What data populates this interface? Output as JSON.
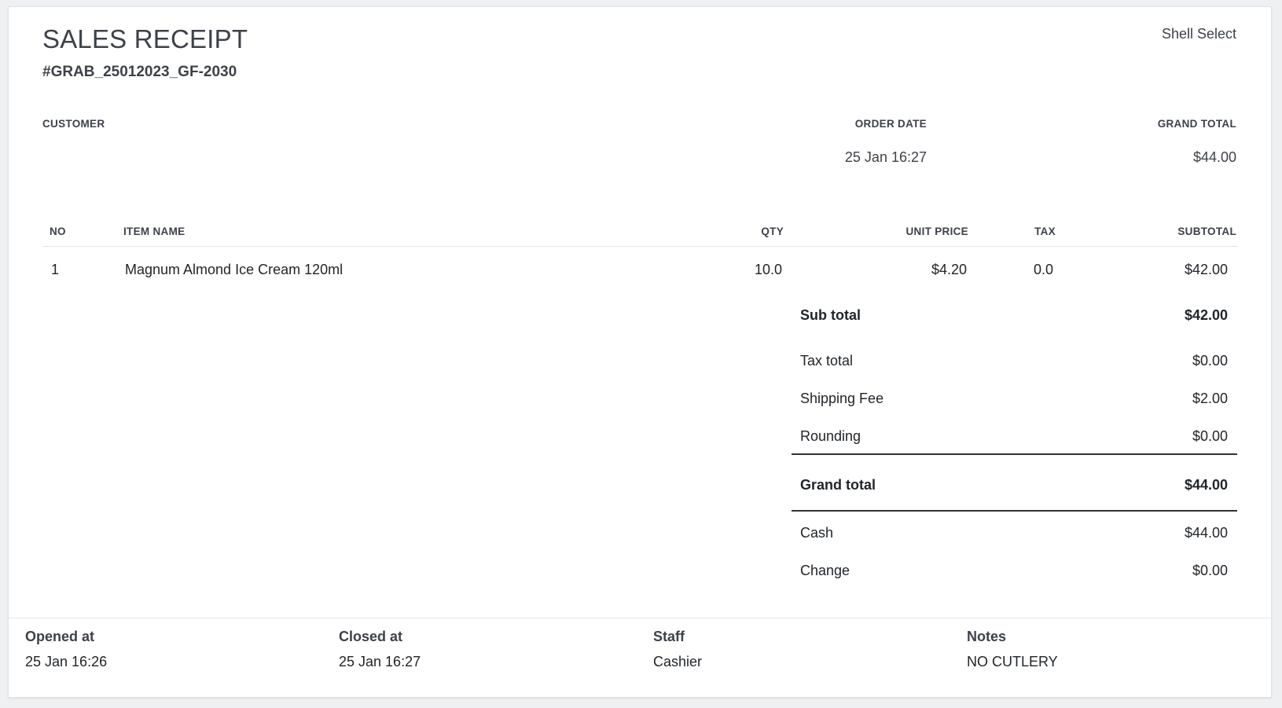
{
  "header": {
    "title": "SALES RECEIPT",
    "receipt_number": "#GRAB_25012023_GF-2030",
    "shop_name": "Shell Select"
  },
  "meta": {
    "customer_label": "CUSTOMER",
    "customer_value": "",
    "order_date_label": "ORDER DATE",
    "order_date_value": "25 Jan 16:27",
    "grand_total_label": "GRAND TOTAL",
    "grand_total_value": "$44.00"
  },
  "table": {
    "columns": [
      "NO",
      "ITEM NAME",
      "QTY",
      "UNIT PRICE",
      "TAX",
      "SUBTOTAL"
    ],
    "rows": [
      {
        "no": "1",
        "item_name": "Magnum Almond Ice Cream 120ml",
        "qty": "10.0",
        "unit_price": "$4.20",
        "tax": "0.0",
        "subtotal": "$42.00"
      }
    ]
  },
  "summary": {
    "sub_total_label": "Sub total",
    "sub_total_value": "$42.00",
    "tax_total_label": "Tax total",
    "tax_total_value": "$0.00",
    "shipping_fee_label": "Shipping Fee",
    "shipping_fee_value": "$2.00",
    "rounding_label": "Rounding",
    "rounding_value": "$0.00",
    "grand_total_label": "Grand total",
    "grand_total_value": "$44.00",
    "cash_label": "Cash",
    "cash_value": "$44.00",
    "change_label": "Change",
    "change_value": "$0.00"
  },
  "footer": {
    "opened_at_label": "Opened at",
    "opened_at_value": "25 Jan 16:26",
    "closed_at_label": "Closed at",
    "closed_at_value": "25 Jan 16:27",
    "staff_label": "Staff",
    "staff_value": "Cashier",
    "notes_label": "Notes",
    "notes_value": "NO CUTLERY"
  }
}
